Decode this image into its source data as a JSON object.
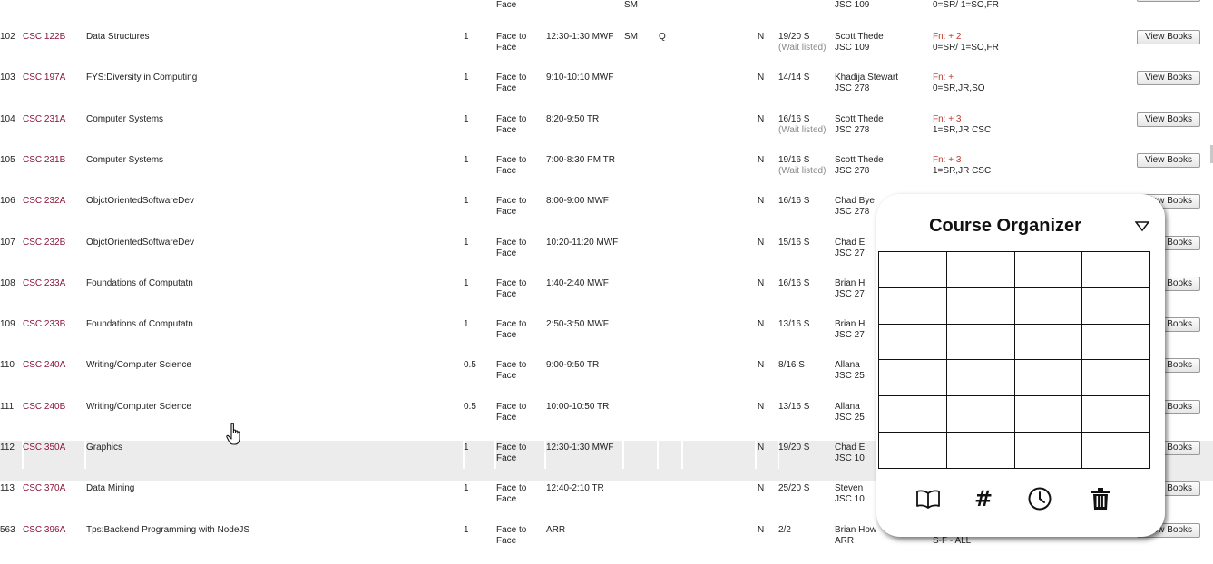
{
  "view_books_label": "View Books",
  "colors": {
    "course_code": "#8b1538",
    "fn_text": "#c0392b",
    "highlight_row": "#ececec"
  },
  "top_partial_row": {
    "mode_line2": "Face",
    "loc_line2": "SM",
    "instructor_line2": "JSC 109",
    "restrictions_line2": "0=SR/ 1=SO,FR"
  },
  "rows": [
    {
      "num": "102",
      "code": "CSC 122B",
      "title": "Data Structures",
      "credits": "1",
      "mode": [
        "Face to",
        "Face"
      ],
      "time": "12:30-1:30 MWF",
      "loc": [
        "",
        "SM"
      ],
      "flag": "Q",
      "n": "N",
      "seats": "19/20  S",
      "wait": "(Wait listed)",
      "instructor": [
        "Scott Thede",
        "JSC 109"
      ],
      "fn": "Fn: + 2",
      "restr": "0=SR/ 1=SO,FR"
    },
    {
      "num": "103",
      "code": "CSC 197A",
      "title": "FYS:Diversity in Computing",
      "credits": "1",
      "mode": [
        "Face to",
        "Face"
      ],
      "time": "9:10-10:10 MWF",
      "loc": [
        "",
        ""
      ],
      "flag": "",
      "n": "N",
      "seats": "14/14  S",
      "wait": "",
      "instructor": [
        "Khadija Stewart",
        "JSC 278"
      ],
      "fn": "Fn: +",
      "restr": "0=SR,JR,SO"
    },
    {
      "num": "104",
      "code": "CSC 231A",
      "title": "Computer Systems",
      "credits": "1",
      "mode": [
        "Face to",
        "Face"
      ],
      "time": "8:20-9:50 TR",
      "loc": [
        "",
        ""
      ],
      "flag": "",
      "n": "N",
      "seats": "16/16  S",
      "wait": "(Wait listed)",
      "instructor": [
        "Scott Thede",
        "JSC 278"
      ],
      "fn": "Fn: + 3",
      "restr": "1=SR,JR CSC"
    },
    {
      "num": "105",
      "code": "CSC 231B",
      "title": "Computer Systems",
      "credits": "1",
      "mode": [
        "Face to",
        "Face"
      ],
      "time": "7:00-8:30 PM TR",
      "loc": [
        "",
        ""
      ],
      "flag": "",
      "n": "N",
      "seats": "19/16  S",
      "wait": "(Wait listed)",
      "instructor": [
        "Scott Thede",
        "JSC 278"
      ],
      "fn": "Fn: + 3",
      "restr": "1=SR,JR CSC"
    },
    {
      "num": "106",
      "code": "CSC 232A",
      "title": "ObjctOrientedSoftwareDev",
      "credits": "1",
      "mode": [
        "Face to",
        "Face"
      ],
      "time": "8:00-9:00 MWF",
      "loc": [
        "",
        ""
      ],
      "flag": "",
      "n": "N",
      "seats": "16/16  S",
      "wait": "",
      "instructor": [
        "Chad Bye",
        "JSC 278"
      ],
      "fn": "",
      "restr": ""
    },
    {
      "num": "107",
      "code": "CSC 232B",
      "title": "ObjctOrientedSoftwareDev",
      "credits": "1",
      "mode": [
        "Face to",
        "Face"
      ],
      "time": "10:20-11:20 MWF",
      "loc": [
        "",
        ""
      ],
      "flag": "",
      "n": "N",
      "seats": "15/16  S",
      "wait": "",
      "instructor": [
        "Chad E",
        "JSC 27"
      ],
      "fn": "",
      "restr": ""
    },
    {
      "num": "108",
      "code": "CSC 233A",
      "title": "Foundations of Computatn",
      "credits": "1",
      "mode": [
        "Face to",
        "Face"
      ],
      "time": "1:40-2:40 MWF",
      "loc": [
        "",
        ""
      ],
      "flag": "",
      "n": "N",
      "seats": "16/16  S",
      "wait": "",
      "instructor": [
        "Brian H",
        "JSC 27"
      ],
      "fn": "",
      "restr": ""
    },
    {
      "num": "109",
      "code": "CSC 233B",
      "title": "Foundations of Computatn",
      "credits": "1",
      "mode": [
        "Face to",
        "Face"
      ],
      "time": "2:50-3:50 MWF",
      "loc": [
        "",
        ""
      ],
      "flag": "",
      "n": "N",
      "seats": "13/16  S",
      "wait": "",
      "instructor": [
        "Brian H",
        "JSC 27"
      ],
      "fn": "",
      "restr": ""
    },
    {
      "num": "110",
      "code": "CSC 240A",
      "title": "Writing/Computer Science",
      "credits": "0.5",
      "mode": [
        "Face to",
        "Face"
      ],
      "time": "9:00-9:50 TR",
      "loc": [
        "",
        ""
      ],
      "flag": "",
      "n": "N",
      "seats": "8/16  S",
      "wait": "",
      "instructor": [
        "Allana",
        "JSC 25"
      ],
      "fn": "",
      "restr": ""
    },
    {
      "num": "111",
      "code": "CSC 240B",
      "title": "Writing/Computer Science",
      "credits": "0.5",
      "mode": [
        "Face to",
        "Face"
      ],
      "time": "10:00-10:50 TR",
      "loc": [
        "",
        ""
      ],
      "flag": "",
      "n": "N",
      "seats": "13/16  S",
      "wait": "",
      "instructor": [
        "Allana",
        "JSC 25"
      ],
      "fn": "",
      "restr": ""
    },
    {
      "num": "112",
      "code": "CSC 350A",
      "title": "Graphics",
      "credits": "1",
      "mode": [
        "Face to",
        "Face"
      ],
      "time": "12:30-1:30 MWF",
      "loc": [
        "",
        ""
      ],
      "flag": "",
      "n": "N",
      "seats": "19/20  S",
      "wait": "",
      "instructor": [
        "Chad E",
        "JSC 10"
      ],
      "fn": "",
      "restr": ""
    },
    {
      "num": "113",
      "code": "CSC 370A",
      "title": "Data Mining",
      "credits": "1",
      "mode": [
        "Face to",
        "Face"
      ],
      "time": "12:40-2:10 TR",
      "loc": [
        "",
        ""
      ],
      "flag": "",
      "n": "N",
      "seats": "25/20  S",
      "wait": "",
      "instructor": [
        "Steven",
        "JSC 10"
      ],
      "fn": "",
      "restr": ""
    },
    {
      "num": "563",
      "code": "CSC 396A",
      "title": "Tps:Backend Programming with NodeJS",
      "credits": "1",
      "mode": [
        "Face to",
        "Face"
      ],
      "time": "ARR",
      "loc": [
        "",
        ""
      ],
      "flag": "",
      "n": "N",
      "seats": "2/2",
      "wait": "",
      "instructor": [
        "Brian How",
        "ARR"
      ],
      "fn": "",
      "restr": "S-F - ALL"
    }
  ],
  "organizer": {
    "title": "Course Organizer",
    "toggle_icon": "triangle-down-icon",
    "grid_rows": 6,
    "grid_cols": 4,
    "tools": [
      "book-icon",
      "hash-icon",
      "clock-icon",
      "trash-icon"
    ],
    "hash_symbol": "#"
  }
}
